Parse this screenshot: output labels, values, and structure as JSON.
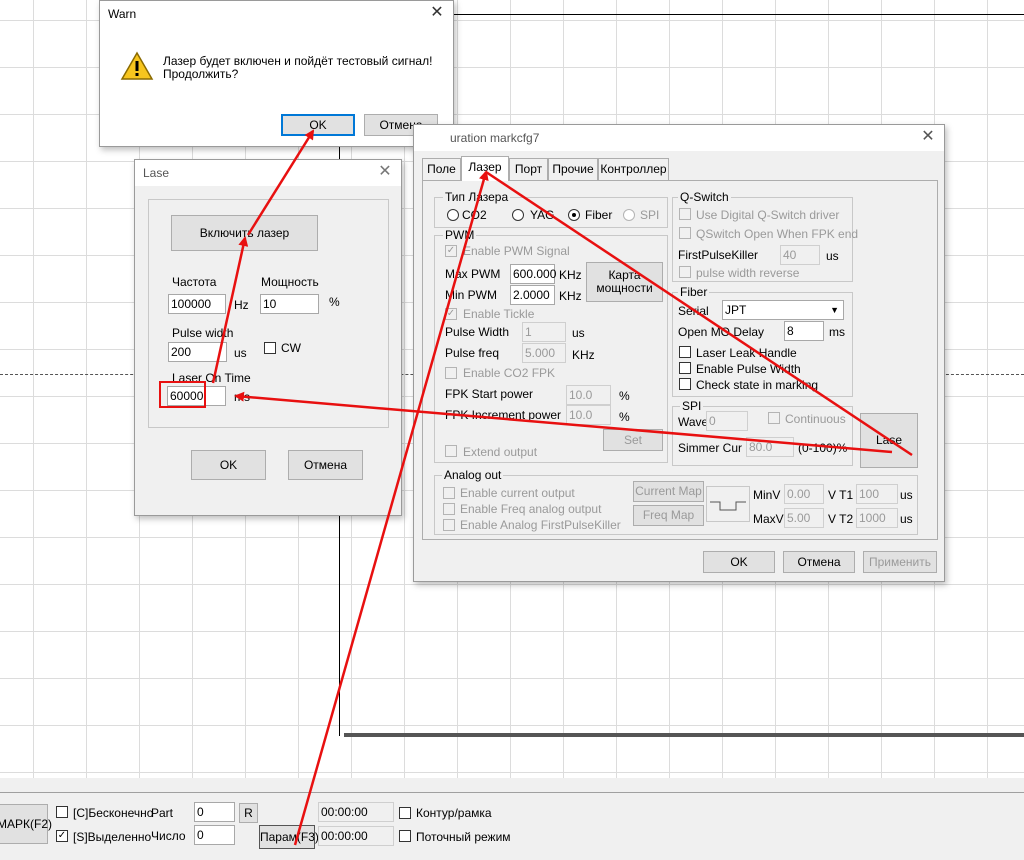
{
  "warn_dialog": {
    "title": "Warn",
    "message_line1": "Лазер будет включен и пойдёт тестовый сигнал!",
    "message_line2": "Продолжить?",
    "ok_label": "OK",
    "cancel_label": "Отмена"
  },
  "lase_dialog": {
    "title": "Lase",
    "enable_laser_label": "Включить лазер",
    "frequency_label": "Частота",
    "frequency_value": "100000",
    "frequency_unit": "Hz",
    "power_label": "Мощность",
    "power_value": "10",
    "power_unit": "%",
    "pulse_width_label": "Pulse width",
    "pulse_width_value": "200",
    "pulse_width_unit": "us",
    "cw_label": "CW",
    "laser_on_time_label": "Laser On Time",
    "laser_on_time_value": "60000",
    "laser_on_time_unit": "ms",
    "ok_label": "OK",
    "cancel_label": "Отмена"
  },
  "config_dialog": {
    "title": "uration markcfg7",
    "tabs": [
      "Поле",
      "Лазер",
      "Порт",
      "Прочие",
      "Контроллер"
    ],
    "active_tab": "Лазер",
    "laser_type": {
      "title": "Тип Лазера",
      "options": [
        "CO2",
        "YAG",
        "Fiber",
        "SPI"
      ],
      "selected": "Fiber"
    },
    "pwm": {
      "title": "PWM",
      "enable_pwm_signal": "Enable PWM Signal",
      "max_pwm_label": "Max PWM",
      "max_pwm_value": "600.000",
      "min_pwm_label": "Min PWM",
      "min_pwm_value": "2.0000",
      "khz_unit": "KHz",
      "power_map_line1": "Карта",
      "power_map_line2": "мощности",
      "enable_tickle": "Enable Tickle",
      "pulse_width_label": "Pulse Width",
      "pulse_width_value": "1",
      "us_unit": "us",
      "pulse_freq_label": "Pulse freq",
      "pulse_freq_value": "5.000",
      "enable_co2_fpk": "Enable CO2 FPK",
      "fpk_start_label": "FPK Start power",
      "fpk_start_value": "10.0",
      "fpk_inc_label": "FPK Increment power",
      "fpk_inc_value": "10.0",
      "percent": "%",
      "set_label": "Set",
      "extend_output": "Extend output"
    },
    "qswitch": {
      "title": "Q-Switch",
      "use_digital": "Use Digital Q-Switch driver",
      "qswitch_open": "QSwitch Open When FPK end",
      "first_pulse_killer_label": "FirstPulseKiller",
      "first_pulse_killer_value": "40",
      "us_unit": "us",
      "pulse_width_reverse": "pulse width reverse"
    },
    "fiber": {
      "title": "Fiber",
      "serial_label": "Serial",
      "serial_value": "JPT",
      "open_mo_delay_label": "Open MO Delay",
      "open_mo_delay_value": "8",
      "ms_unit": "ms",
      "laser_leak_handle": "Laser Leak Handle",
      "enable_pulse_width": "Enable Pulse Width",
      "check_state": "Check state in marking"
    },
    "spi": {
      "title": "SPI",
      "wave_label": "Wave",
      "wave_value": "0",
      "continuous_label": "Continuous",
      "simmer_label": "Simmer Cur",
      "simmer_value": "80.0",
      "simmer_range": "(0-100)%"
    },
    "lase_button": "Lase",
    "analog_out": {
      "title": "Analog out",
      "enable_current": "Enable current output",
      "enable_freq": "Enable Freq analog output",
      "enable_analog_fpk": "Enable Analog FirstPulseKiller",
      "current_map": "Current Map",
      "freq_map": "Freq Map",
      "minv_label": "MinV",
      "minv_value": "0.00",
      "maxv_label": "MaxV",
      "maxv_value": "5.00",
      "v_t1": "V  T1",
      "v_t2": "V  T2",
      "t1_value": "100",
      "t2_value": "1000",
      "us_unit": "us"
    },
    "ok_label": "OK",
    "cancel_label": "Отмена",
    "apply_label": "Применить"
  },
  "bottom_bar": {
    "mark_label": "МАРК(F2)",
    "continuous_label": "[C]Бесконечно",
    "selected_label": "[S]Выделенно",
    "part_label": "Part",
    "part_value": "0",
    "r_label": "R",
    "count_label": "Число",
    "count_value": "0",
    "param_label": "Парам(F3)",
    "time1": "00:00:00",
    "time2": "00:00:00",
    "contour_label": "Контур/рамка",
    "stream_label": "Поточный режим"
  },
  "colors": {
    "annotation_red": "#e81010",
    "accent_blue": "#0078d7"
  }
}
